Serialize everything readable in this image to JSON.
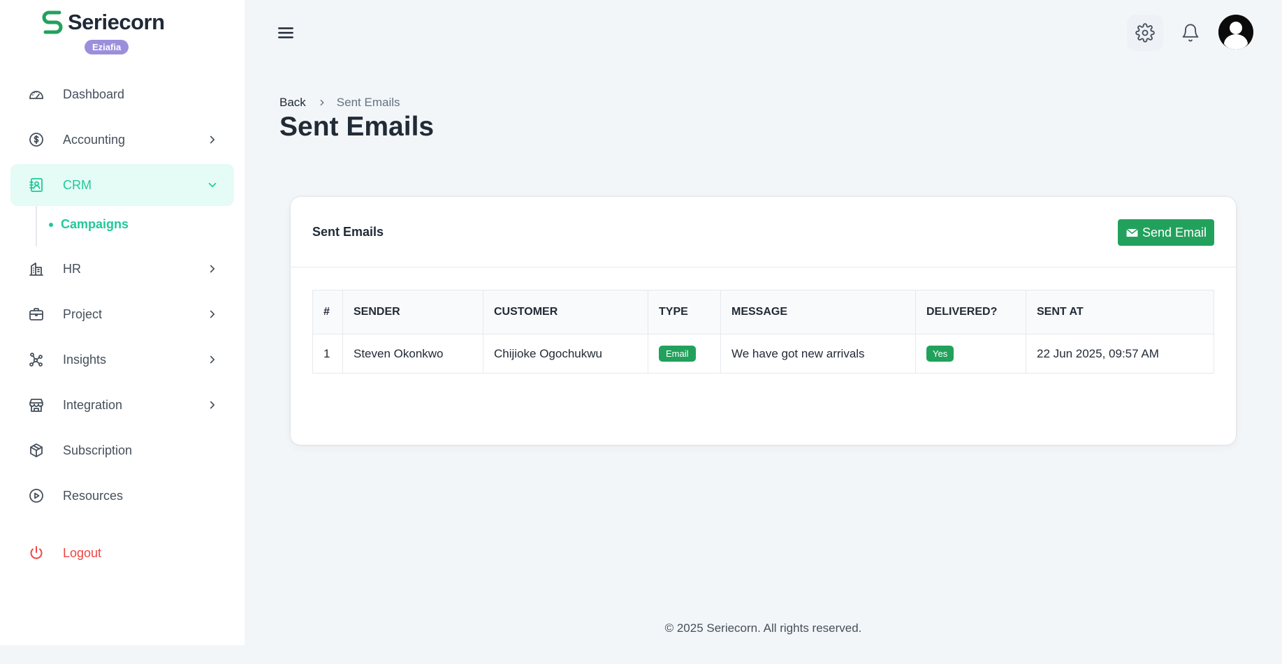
{
  "brand": {
    "name": "Seriecorn",
    "badge": "Eziafia"
  },
  "sidebar": {
    "items": [
      {
        "label": "Dashboard",
        "icon": "gauge-icon"
      },
      {
        "label": "Accounting",
        "icon": "dollar-circle-icon"
      },
      {
        "label": "CRM",
        "icon": "contact-book-icon"
      },
      {
        "label": "HR",
        "icon": "building-icon"
      },
      {
        "label": "Project",
        "icon": "briefcase-icon"
      },
      {
        "label": "Insights",
        "icon": "network-icon"
      },
      {
        "label": "Integration",
        "icon": "store-icon"
      },
      {
        "label": "Subscription",
        "icon": "box-icon"
      },
      {
        "label": "Resources",
        "icon": "play-circle-icon"
      }
    ],
    "crm_sub": {
      "label": "Campaigns"
    },
    "logout": "Logout"
  },
  "breadcrumb": {
    "back": "Back",
    "current": "Sent Emails"
  },
  "page_title": "Sent Emails",
  "card": {
    "title": "Sent Emails",
    "send_button": "Send Email",
    "columns": [
      "#",
      "SENDER",
      "CUSTOMER",
      "TYPE",
      "MESSAGE",
      "DELIVERED?",
      "SENT AT"
    ],
    "rows": [
      {
        "num": "1",
        "sender": "Steven Okonkwo",
        "customer": "Chijioke Ogochukwu",
        "type": "Email",
        "message": "We have got new arrivals",
        "delivered": "Yes",
        "sent_at": "22 Jun 2025, 09:57 AM"
      }
    ]
  },
  "footer": "© 2025 Seriecorn. All rights reserved.",
  "colors": {
    "accent": "#22c89a",
    "button": "#22a15c",
    "badge": "#9b8fdc",
    "logout": "#ef4444"
  }
}
